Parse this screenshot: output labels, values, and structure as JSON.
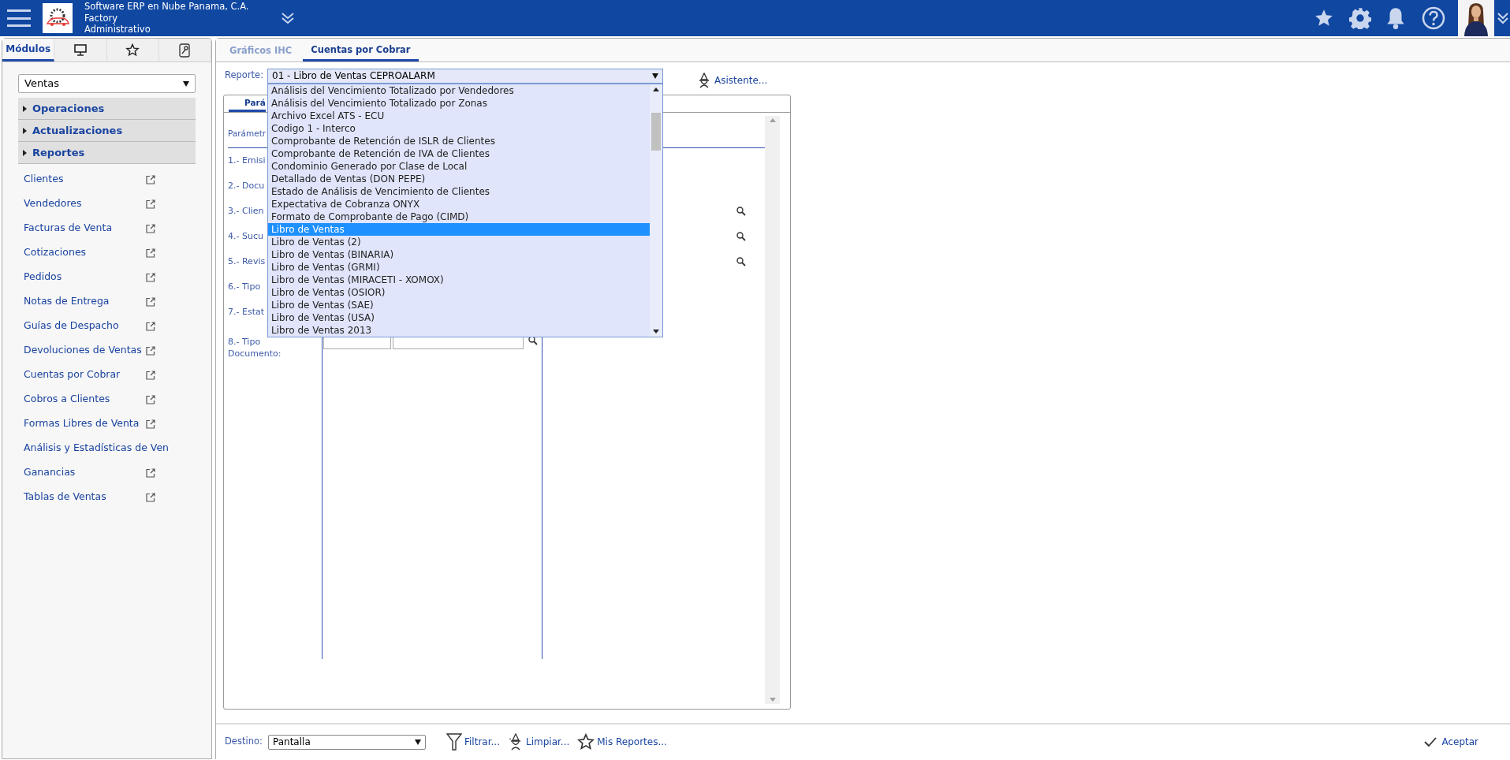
{
  "header": {
    "company": "Software ERP en Nube Panama, C.A.",
    "line_2": "Factory",
    "line_3": "Administrativo"
  },
  "sidebar": {
    "tabs": [
      {
        "kind": "text",
        "label": "Módulos",
        "selected": true
      },
      {
        "kind": "monitor",
        "selected": false
      },
      {
        "kind": "star",
        "selected": false
      },
      {
        "kind": "key",
        "selected": false
      }
    ],
    "module_select": {
      "value": "Ventas"
    },
    "sections": [
      {
        "label": "Operaciones",
        "expanded": false
      },
      {
        "label": "Actualizaciones",
        "expanded": false
      },
      {
        "label": "Reportes",
        "expanded": false
      }
    ],
    "links": [
      {
        "label": "Clientes"
      },
      {
        "label": "Vendedores"
      },
      {
        "label": "Facturas de Venta"
      },
      {
        "label": "Cotizaciones"
      },
      {
        "label": "Pedidos"
      },
      {
        "label": "Notas de Entrega"
      },
      {
        "label": "Guías de Despacho"
      },
      {
        "label": "Devoluciones de Ventas"
      },
      {
        "label": "Cuentas por Cobrar"
      },
      {
        "label": "Cobros a Clientes"
      },
      {
        "label": "Formas Libres de Venta"
      },
      {
        "label": "Análisis y Estadísticas de Ven"
      },
      {
        "label": "Ganancias"
      },
      {
        "label": "Tablas de Ventas"
      }
    ]
  },
  "main": {
    "tabs": [
      {
        "label": "Gráficos IHC",
        "selected": false
      },
      {
        "label": "Cuentas por Cobrar",
        "selected": true
      }
    ],
    "report": {
      "label": "Reporte:",
      "value": "01 - Libro de Ventas CEPROALARM",
      "expanded": true,
      "options": [
        {
          "label": "Análisis del Vencimiento Totalizado por Vendedores",
          "selected": false
        },
        {
          "label": "Análisis del Vencimiento Totalizado por Zonas",
          "selected": false
        },
        {
          "label": "Archivo Excel ATS - ECU",
          "selected": false
        },
        {
          "label": "Codigo 1 - Interco",
          "selected": false
        },
        {
          "label": "Comprobante de Retención de ISLR de Clientes",
          "selected": false
        },
        {
          "label": "Comprobante de Retención de IVA de Clientes",
          "selected": false
        },
        {
          "label": "Condominio Generado por Clase de Local",
          "selected": false
        },
        {
          "label": "Detallado de Ventas (DON PEPE)",
          "selected": false
        },
        {
          "label": "Estado de Análisis de Vencimiento de Clientes",
          "selected": false
        },
        {
          "label": "Expectativa de Cobranza ONYX",
          "selected": false
        },
        {
          "label": "Formato de Comprobante de Pago (CIMD)",
          "selected": false
        },
        {
          "label": "Libro de Ventas",
          "selected": true
        },
        {
          "label": "Libro de Ventas (2)",
          "selected": false
        },
        {
          "label": "Libro de Ventas (BINARIA)",
          "selected": false
        },
        {
          "label": "Libro de Ventas (GRMI)",
          "selected": false
        },
        {
          "label": "Libro de Ventas (MIRACETI - XOMOX)",
          "selected": false
        },
        {
          "label": "Libro de Ventas (OSIOR)",
          "selected": false
        },
        {
          "label": "Libro de Ventas (SAE)",
          "selected": false
        },
        {
          "label": "Libro de Ventas (USA)",
          "selected": false
        },
        {
          "label": "Libro de Ventas 2013",
          "selected": false
        }
      ]
    },
    "assistant_button": "Asistente...",
    "params_panel": {
      "tabs": [
        {
          "label": "Pará",
          "selected": true
        }
      ],
      "heading": "Parámetr",
      "rows": [
        {
          "label": "1.- Emisi",
          "kind": "plain"
        },
        {
          "label": "2.- Docu",
          "kind": "plain"
        },
        {
          "label": "3.- Clien",
          "kind": "lookup"
        },
        {
          "label": "4.- Sucu",
          "kind": "lookup"
        },
        {
          "label": "5.- Revis",
          "kind": "lookup"
        },
        {
          "label": "6.- Tipo",
          "kind": "plain"
        },
        {
          "label": "7.- Estat",
          "kind": "plain"
        },
        {
          "label": "8.- Tipo Documento:",
          "kind": "range"
        }
      ]
    }
  },
  "footer": {
    "destination_label": "Destino:",
    "destination_value": "Pantalla",
    "actions": [
      {
        "label": "Filtrar...",
        "kind": "filter"
      },
      {
        "label": "Limpiar...",
        "kind": "wizard"
      },
      {
        "label": "Mis Reportes...",
        "kind": "star"
      }
    ],
    "accept": "Aceptar"
  }
}
